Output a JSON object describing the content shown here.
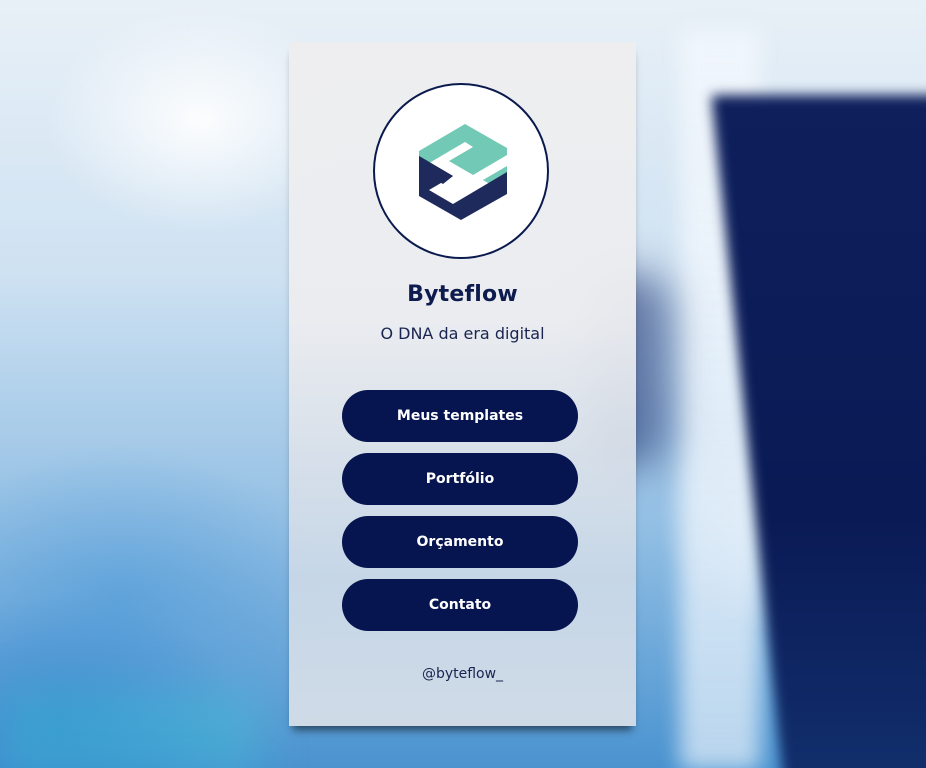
{
  "profile": {
    "name": "Byteflow",
    "tagline": "O DNA da era digital",
    "handle": "@byteflow_"
  },
  "links": [
    {
      "label": "Meus templates"
    },
    {
      "label": "Portfólio"
    },
    {
      "label": "Orçamento"
    },
    {
      "label": "Contato"
    }
  ],
  "colors": {
    "button": "#06154f",
    "logo_teal": "#72c9b6",
    "logo_navy": "#1f2a5c",
    "text": "#0d1b4e"
  }
}
